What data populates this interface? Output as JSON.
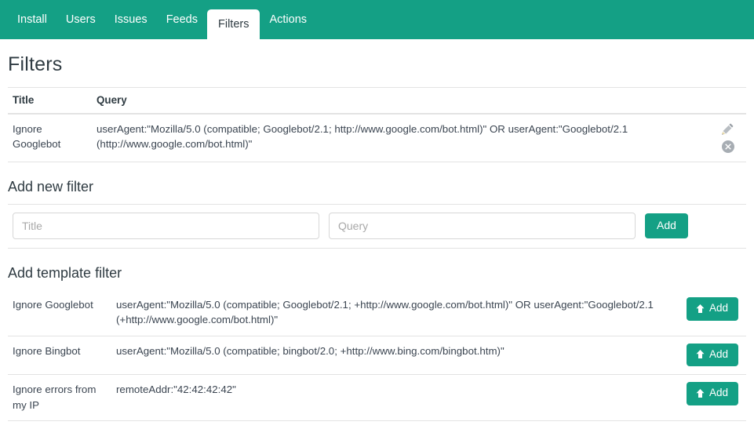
{
  "theme": {
    "accent": "#14a085",
    "text": "#2f3b42",
    "border": "#e3e3e3"
  },
  "nav": {
    "tabs": [
      {
        "label": "Install",
        "active": false
      },
      {
        "label": "Users",
        "active": false
      },
      {
        "label": "Issues",
        "active": false
      },
      {
        "label": "Feeds",
        "active": false
      },
      {
        "label": "Filters",
        "active": true
      },
      {
        "label": "Actions",
        "active": false
      }
    ]
  },
  "page": {
    "title": "Filters"
  },
  "filters_table": {
    "headers": {
      "title": "Title",
      "query": "Query"
    },
    "rows": [
      {
        "title": "Ignore Googlebot",
        "query": "userAgent:\"Mozilla/5.0 (compatible; Googlebot/2.1; http://www.google.com/bot.html)\" OR userAgent:\"Googlebot/2.1 (http://www.google.com/bot.html)\"",
        "edit_icon": "pencil-icon",
        "delete_icon": "circle-x-icon"
      }
    ]
  },
  "add_new_filter": {
    "heading": "Add new filter",
    "title_placeholder": "Title",
    "title_value": "",
    "query_placeholder": "Query",
    "query_value": "",
    "add_label": "Add"
  },
  "add_template_filter": {
    "heading": "Add template filter",
    "add_label": "Add",
    "add_icon": "arrow-up-icon",
    "rows": [
      {
        "title": "Ignore Googlebot",
        "query": "userAgent:\"Mozilla/5.0 (compatible; Googlebot/2.1; +http://www.google.com/bot.html)\" OR userAgent:\"Googlebot/2.1 (+http://www.google.com/bot.html)\""
      },
      {
        "title": "Ignore Bingbot",
        "query": "userAgent:\"Mozilla/5.0 (compatible; bingbot/2.0; +http://www.bing.com/bingbot.htm)\""
      },
      {
        "title": "Ignore errors from my IP",
        "query": "remoteAddr:\"42:42:42:42\""
      }
    ]
  }
}
